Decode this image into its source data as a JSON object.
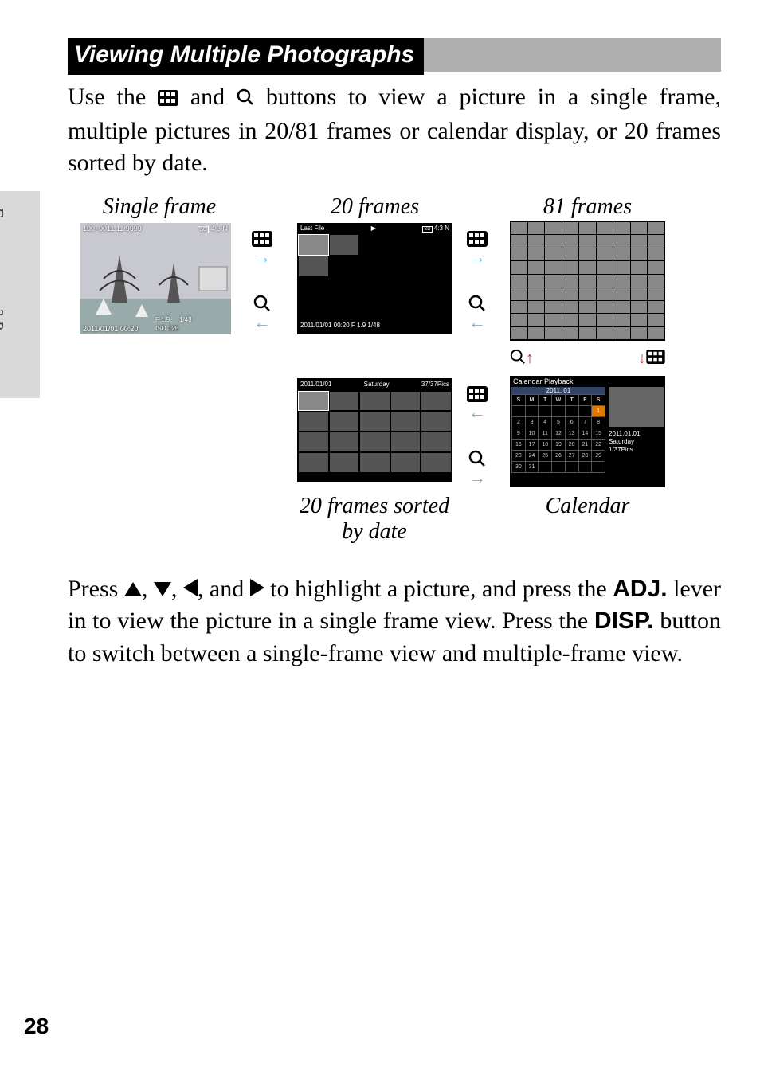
{
  "side_tab": "First-time user? Read this.",
  "heading": "Viewing Multiple Photographs",
  "intro_1a": "Use the ",
  "intro_1b": " and ",
  "intro_1c": " buttons to view a picture in a single frame, multiple pictures in 20/81 frames or calendar display, or 20 frames sorted by date.",
  "labels": {
    "single": "Single frame",
    "f20": "20 frames",
    "f81": "81 frames",
    "sort": "20 frames sorted by date",
    "calendar": "Calendar"
  },
  "single_overlay": {
    "tl": "100–0011    11/9999",
    "tr": "4:3 N",
    "bl": "2011/01/01 00:20",
    "bc1": "F 1.9",
    "bc2": "ISO 125",
    "bc3": "1/48"
  },
  "grid20": {
    "hdr_left": "Last File",
    "hdr_right": "4:3 N",
    "footer": "2011/01/01 00:20   F 1.9 1/48"
  },
  "sort20": {
    "date": "2011/01/01",
    "day": "Saturday",
    "count": "37/37Pics"
  },
  "calendar_box": {
    "title": "Calendar Playback",
    "month": "2011. 01",
    "dow": [
      "S",
      "M",
      "T",
      "W",
      "T",
      "F",
      "S"
    ],
    "side_date": "2011.01.01",
    "side_day": "Saturday",
    "side_count": "1/37Pics"
  },
  "body2_a": "Press ",
  "body2_b": ", ",
  "body2_c": ", ",
  "body2_d": ", and ",
  "body2_e": " to highlight a picture, and press the ",
  "body2_adj": "ADJ.",
  "body2_f": " lever in to view the picture in a single frame view. Press the ",
  "body2_disp": "DISP.",
  "body2_g": " button to switch between a single-frame view and multiple-frame view.",
  "page": "28"
}
